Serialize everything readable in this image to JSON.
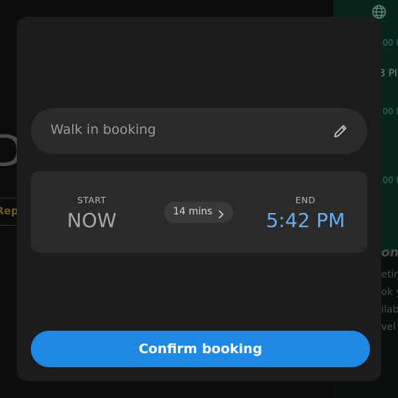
{
  "background": {
    "right_panel_times": [
      "00 I",
      "3 PI",
      "00 I",
      "00 I"
    ],
    "right_panel_snippets": [
      "ono",
      "eting",
      "ok y",
      "ilabl",
      "vel"
    ],
    "left_fragment": "D",
    "left_tab": "Rep"
  },
  "modal": {
    "title_field": {
      "value": "Walk in booking"
    },
    "time": {
      "start_caption": "START",
      "start_value": "NOW",
      "duration_label": "14 mins",
      "end_caption": "END",
      "end_value": "5:42 PM"
    },
    "confirm_label": "Confirm booking"
  },
  "colors": {
    "accent": "#1e88e5",
    "end_time": "#63adf0",
    "modal_bg": "#1c1c1e"
  },
  "icons": [
    "globe-icon",
    "pencil-icon",
    "chevron-right-icon"
  ]
}
